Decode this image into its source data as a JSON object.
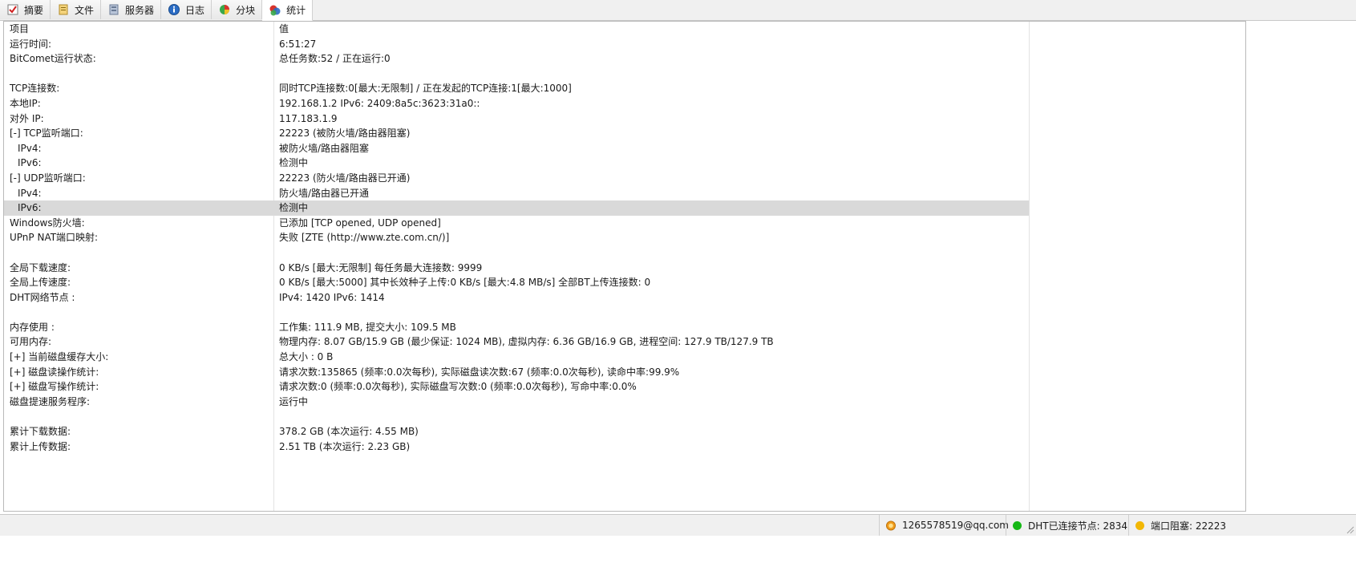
{
  "tabs": [
    {
      "label": "摘要",
      "icon": "summary-check-icon"
    },
    {
      "label": "文件",
      "icon": "file-icon"
    },
    {
      "label": "服务器",
      "icon": "server-icon"
    },
    {
      "label": "日志",
      "icon": "info-icon"
    },
    {
      "label": "分块",
      "icon": "pie-icon"
    },
    {
      "label": "统计",
      "icon": "stats-icon",
      "active": true
    }
  ],
  "table": {
    "header": {
      "key": "项目",
      "value": "值"
    },
    "rows": [
      {
        "key": "运行时间:",
        "value": "6:51:27"
      },
      {
        "key": "BitComet运行状态:",
        "value": "总任务数:52 / 正在运行:0"
      },
      {
        "key": "",
        "value": ""
      },
      {
        "key": "TCP连接数:",
        "value": "同时TCP连接数:0[最大:无限制] / 正在发起的TCP连接:1[最大:1000]"
      },
      {
        "key": "本地IP:",
        "value": "192.168.1.2    IPv6: 2409:8a5c:3623:31a0::"
      },
      {
        "key": "对外 IP:",
        "value": "117.183.1.9"
      },
      {
        "key": "[-] TCP监听端口:",
        "value": "22223 (被防火墙/路由器阻塞)"
      },
      {
        "key": "IPv4:",
        "value": "被防火墙/路由器阻塞",
        "indent": true
      },
      {
        "key": "IPv6:",
        "value": "检测中",
        "indent": true
      },
      {
        "key": "[-] UDP监听端口:",
        "value": "22223 (防火墙/路由器已开通)"
      },
      {
        "key": "IPv4:",
        "value": "防火墙/路由器已开通",
        "indent": true
      },
      {
        "key": "IPv6:",
        "value": "检测中",
        "indent": true,
        "selected": true
      },
      {
        "key": "Windows防火墙:",
        "value": "已添加 [TCP opened, UDP opened]"
      },
      {
        "key": "UPnP NAT端口映射:",
        "value": "失败 [ZTE (http://www.zte.com.cn/)]"
      },
      {
        "key": "",
        "value": ""
      },
      {
        "key": "全局下载速度:",
        "value": "0 KB/s [最大:无限制]     每任务最大连接数: 9999"
      },
      {
        "key": "全局上传速度:",
        "value": "0 KB/s [最大:5000]     其中长效种子上传:0 KB/s [最大:4.8 MB/s]     全部BT上传连接数: 0"
      },
      {
        "key": "DHT网络节点 :",
        "value": "IPv4: 1420  IPv6: 1414"
      },
      {
        "key": "",
        "value": ""
      },
      {
        "key": "内存使用 :",
        "value": "工作集: 111.9 MB, 提交大小: 109.5 MB"
      },
      {
        "key": "可用内存:",
        "value": "物理内存: 8.07 GB/15.9 GB (最少保证: 1024 MB), 虚拟内存: 6.36 GB/16.9 GB, 进程空间: 127.9 TB/127.9 TB"
      },
      {
        "key": "[+] 当前磁盘缓存大小:",
        "value": "总大小 : 0 B"
      },
      {
        "key": "[+] 磁盘读操作统计:",
        "value": "请求次数:135865 (频率:0.0次每秒), 实际磁盘读次数:67 (频率:0.0次每秒), 读命中率:99.9%"
      },
      {
        "key": "[+] 磁盘写操作统计:",
        "value": "请求次数:0 (频率:0.0次每秒), 实际磁盘写次数:0 (频率:0.0次每秒), 写命中率:0.0%"
      },
      {
        "key": "磁盘提速服务程序:",
        "value": "运行中"
      },
      {
        "key": "",
        "value": ""
      },
      {
        "key": "累计下载数据:",
        "value": "378.2 GB (本次运行: 4.55 MB)"
      },
      {
        "key": "累计上传数据:",
        "value": "2.51 TB (本次运行: 2.23 GB)"
      }
    ]
  },
  "statusbar": {
    "account": "1265578519@qq.com",
    "dht": "DHT已连接节点: 2834",
    "port": "端口阻塞: 22223"
  },
  "colors": {
    "selected_row": "#d9d9d9",
    "dht_dot": "#16b816",
    "port_dot": "#f2b705",
    "account_icon": "#f09a1a"
  }
}
